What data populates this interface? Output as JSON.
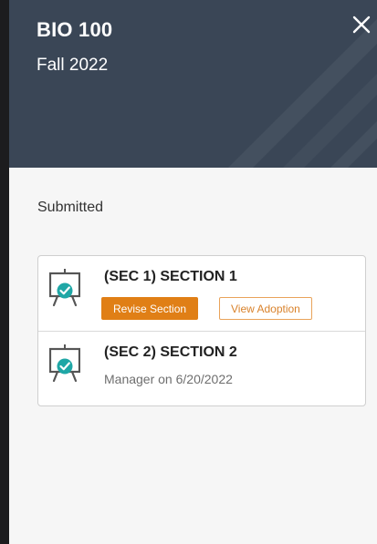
{
  "header": {
    "course_code": "BIO 100",
    "term": "Fall 2022",
    "close_icon": "close-icon"
  },
  "status_heading": "Submitted",
  "sections": [
    {
      "title": "(SEC 1) SECTION 1",
      "icon": "presentation-check-icon",
      "revise_label": "Revise Section",
      "view_label": "View Adoption"
    },
    {
      "title": "(SEC 2) SECTION 2",
      "icon": "presentation-check-icon",
      "subtitle": "Manager on 6/20/2022"
    }
  ],
  "colors": {
    "header_bg": "#3a4656",
    "accent": "#e07f16",
    "check_teal": "#1fa7a6"
  }
}
